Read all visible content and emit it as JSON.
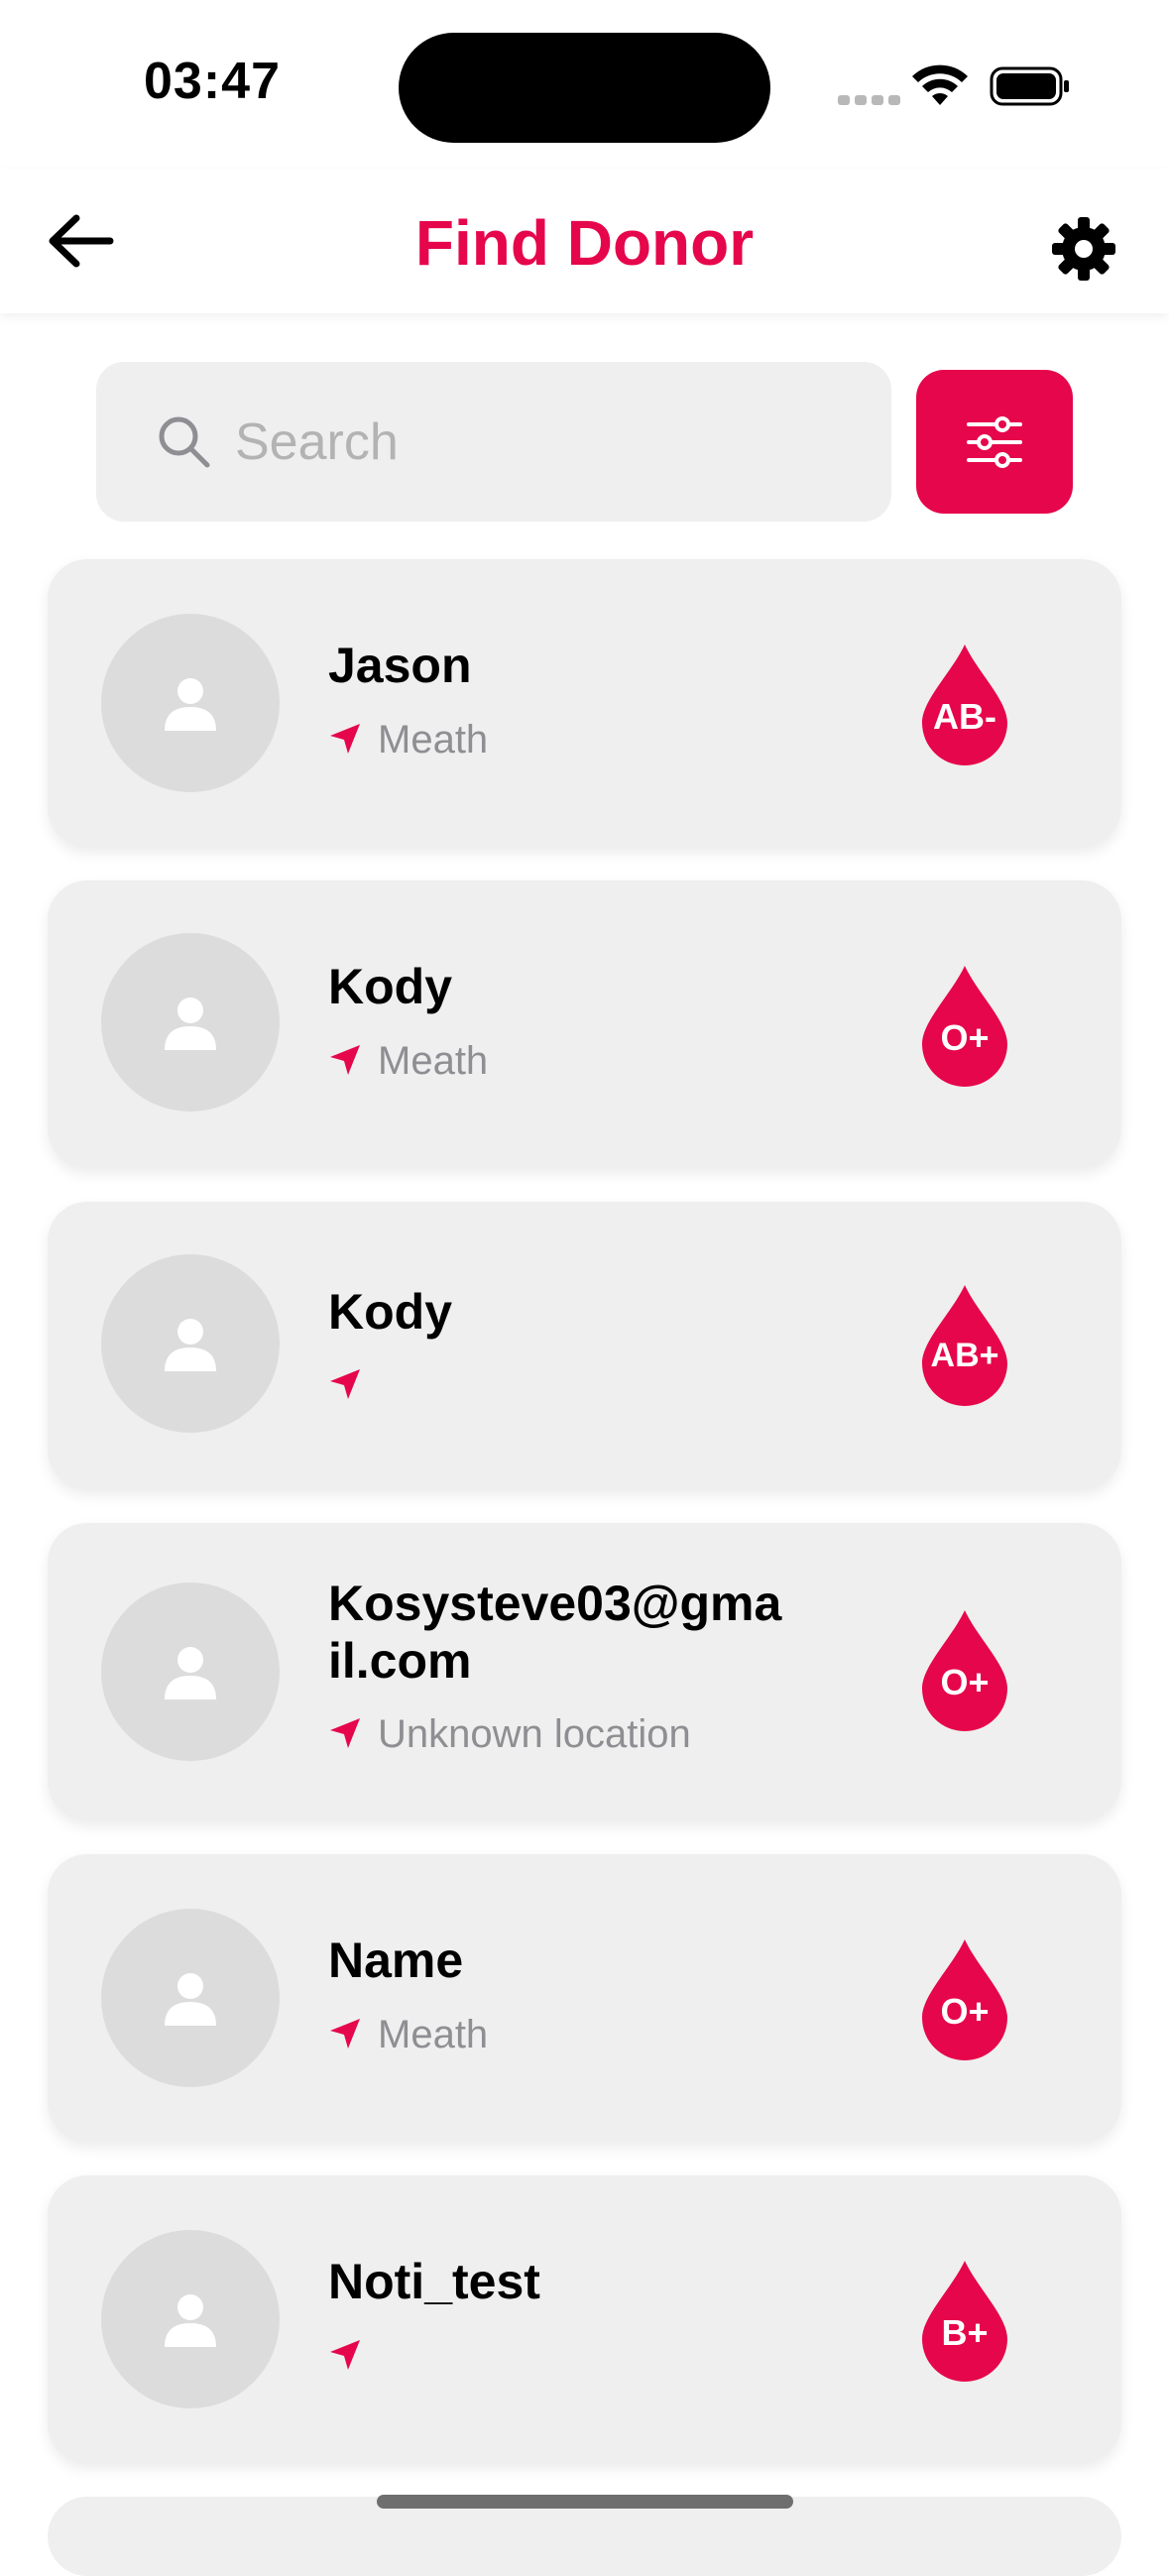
{
  "status_bar": {
    "time": "03:47"
  },
  "header": {
    "title": "Find Donor"
  },
  "search": {
    "placeholder": "Search",
    "value": ""
  },
  "colors": {
    "accent": "#e6064b",
    "card_bg": "#efefef",
    "avatar_bg": "#dcdcdc",
    "secondary_text": "#8e8e93"
  },
  "icons": {
    "back": "arrow-left-icon",
    "settings": "gear-icon",
    "search": "search-icon",
    "filter": "sliders-icon",
    "location": "location-arrow-icon",
    "avatar": "person-icon",
    "blood_type": "blood-drop-icon"
  },
  "donors": [
    {
      "name": "Jason",
      "location": "Meath",
      "blood_type": "AB-"
    },
    {
      "name": "Kody",
      "location": "Meath",
      "blood_type": "O+"
    },
    {
      "name": "Kody",
      "location": "",
      "blood_type": "AB+"
    },
    {
      "name": "Kosysteve03@gmail.com",
      "location": "Unknown location",
      "blood_type": "O+"
    },
    {
      "name": "Name",
      "location": "Meath",
      "blood_type": "O+"
    },
    {
      "name": "Noti_test",
      "location": "",
      "blood_type": "B+"
    }
  ]
}
